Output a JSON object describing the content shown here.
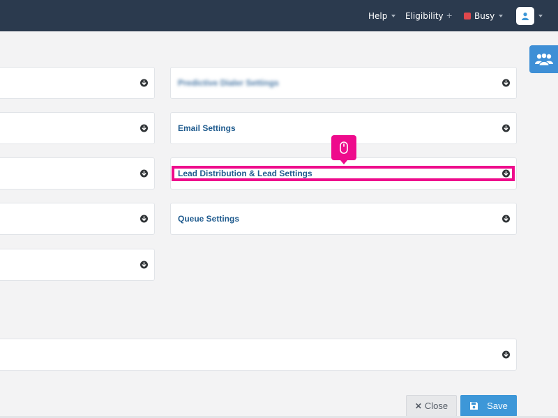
{
  "topbar": {
    "help_label": "Help",
    "eligibility_label": "Eligibility",
    "eligibility_suffix": "+",
    "status_label": "Busy",
    "status_color": "#e0474c"
  },
  "panels": {
    "left_1": "",
    "left_2": "",
    "left_3": "",
    "left_4": "",
    "left_5": "",
    "right_1": "Predictive Dialer Settings",
    "right_2": "Email Settings",
    "right_3": "Lead Distribution & Lead Settings",
    "right_4": "Queue Settings",
    "wide": ""
  },
  "icons": {
    "panel_toggle": "arrow-circle-down-icon",
    "cursor": "mouse-icon",
    "side_tab": "users-icon",
    "avatar": "user-icon"
  },
  "footer": {
    "close_label": "Close",
    "save_label": "Save"
  },
  "colors": {
    "topbar_bg": "#2b3a4e",
    "accent": "#3d97d8",
    "highlight": "#ee0b8c",
    "title_text": "#1f5b8e"
  }
}
